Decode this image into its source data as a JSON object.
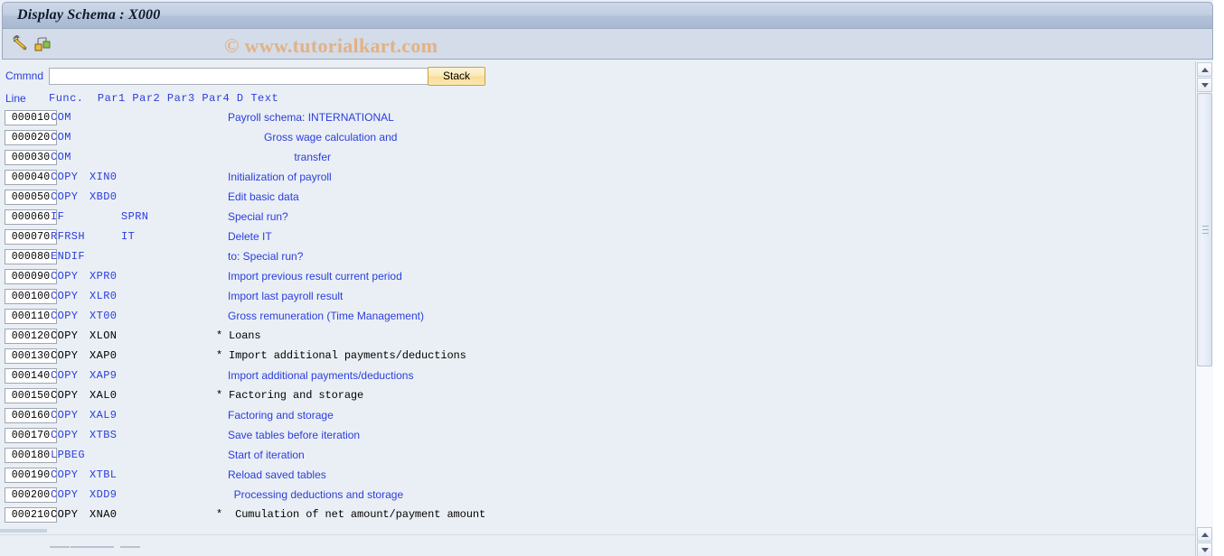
{
  "window": {
    "title": "Display Schema : X000"
  },
  "toolbar": {
    "icons": [
      {
        "name": "edit-pencil-icon",
        "glyph": "pencil"
      },
      {
        "name": "hierarchy-structure-icon",
        "glyph": "structure"
      }
    ]
  },
  "watermark": {
    "text": "© www.tutorialkart.com",
    "color": "#e3b184"
  },
  "command_bar": {
    "label": "Cmmnd",
    "value": "",
    "placeholder": "",
    "stack_label": "Stack"
  },
  "table": {
    "headers": {
      "line": "Line",
      "rest": "Func.  Par1 Par2 Par3 Par4 D Text"
    },
    "columns": [
      "Line",
      "Func.",
      "Par1",
      "Par2",
      "Par3",
      "Par4",
      "D",
      "Text"
    ],
    "rows": [
      {
        "line": "000010",
        "func": "COM",
        "par1": "",
        "par2": "",
        "d": "",
        "text": "Payroll schema: INTERNATIONAL",
        "color": "blue"
      },
      {
        "line": "000020",
        "func": "COM",
        "par1": "",
        "par2": "",
        "d": "",
        "text": "            Gross wage calculation and",
        "color": "blue"
      },
      {
        "line": "000030",
        "func": "COM",
        "par1": "",
        "par2": "",
        "d": "",
        "text": "                      transfer",
        "color": "blue"
      },
      {
        "line": "000040",
        "func": "COPY",
        "par1": "XIN0",
        "par2": "",
        "d": "",
        "text": "Initialization of payroll",
        "color": "blue"
      },
      {
        "line": "000050",
        "func": "COPY",
        "par1": "XBD0",
        "par2": "",
        "d": "",
        "text": "Edit basic data",
        "color": "blue"
      },
      {
        "line": "000060",
        "func": "IF",
        "par1": "",
        "par2": "SPRN",
        "d": "",
        "text": "Special run?",
        "color": "blue"
      },
      {
        "line": "000070",
        "func": "RFRSH",
        "par1": "",
        "par2": "IT",
        "d": "",
        "text": "Delete IT",
        "color": "blue"
      },
      {
        "line": "000080",
        "func": "ENDIF",
        "par1": "",
        "par2": "",
        "d": "",
        "text": "to: Special run?",
        "color": "blue"
      },
      {
        "line": "000090",
        "func": "COPY",
        "par1": "XPR0",
        "par2": "",
        "d": "",
        "text": "Import previous result current period",
        "color": "blue"
      },
      {
        "line": "000100",
        "func": "COPY",
        "par1": "XLR0",
        "par2": "",
        "d": "",
        "text": "Import last payroll result",
        "color": "blue"
      },
      {
        "line": "000110",
        "func": "COPY",
        "par1": "XT00",
        "par2": "",
        "d": "",
        "text": "Gross remuneration (Time Management)",
        "color": "blue"
      },
      {
        "line": "000120",
        "func": "COPY",
        "par1": "XLON",
        "par2": "",
        "d": "*",
        "text": "Loans",
        "color": "black"
      },
      {
        "line": "000130",
        "func": "COPY",
        "par1": "XAP0",
        "par2": "",
        "d": "*",
        "text": "Import additional payments/deductions",
        "color": "black"
      },
      {
        "line": "000140",
        "func": "COPY",
        "par1": "XAP9",
        "par2": "",
        "d": "",
        "text": "Import additional payments/deductions",
        "color": "blue"
      },
      {
        "line": "000150",
        "func": "COPY",
        "par1": "XAL0",
        "par2": "",
        "d": "*",
        "text": "Factoring and storage",
        "color": "black"
      },
      {
        "line": "000160",
        "func": "COPY",
        "par1": "XAL9",
        "par2": "",
        "d": "",
        "text": "Factoring and storage",
        "color": "blue"
      },
      {
        "line": "000170",
        "func": "COPY",
        "par1": "XTBS",
        "par2": "",
        "d": "",
        "text": "Save tables before iteration",
        "color": "blue"
      },
      {
        "line": "000180",
        "func": "LPBEG",
        "par1": "",
        "par2": "",
        "d": "",
        "text": "Start of iteration",
        "color": "blue"
      },
      {
        "line": "000190",
        "func": "COPY",
        "par1": "XTBL",
        "par2": "",
        "d": "",
        "text": "Reload saved tables",
        "color": "blue"
      },
      {
        "line": "000200",
        "func": "COPY",
        "par1": "XDD9",
        "par2": "",
        "d": "",
        "text": "  Processing deductions and storage",
        "color": "blue"
      },
      {
        "line": "000210",
        "func": "COPY",
        "par1": "XNA0",
        "par2": "",
        "d": "*",
        "text": " Cumulation of net amount/payment amount",
        "color": "black"
      }
    ]
  },
  "scrollbars": {
    "vertical": {
      "up_label": "▲",
      "down_label": "▼"
    },
    "horizontal": {
      "visible": true
    }
  },
  "colors": {
    "accent_blue": "#2b3ddd",
    "title_bar": "#b2c1d8",
    "toolbar": "#d3dce8",
    "background": "#eaeff5",
    "stack_button": "#f7dd96",
    "watermark": "#e3b184"
  }
}
